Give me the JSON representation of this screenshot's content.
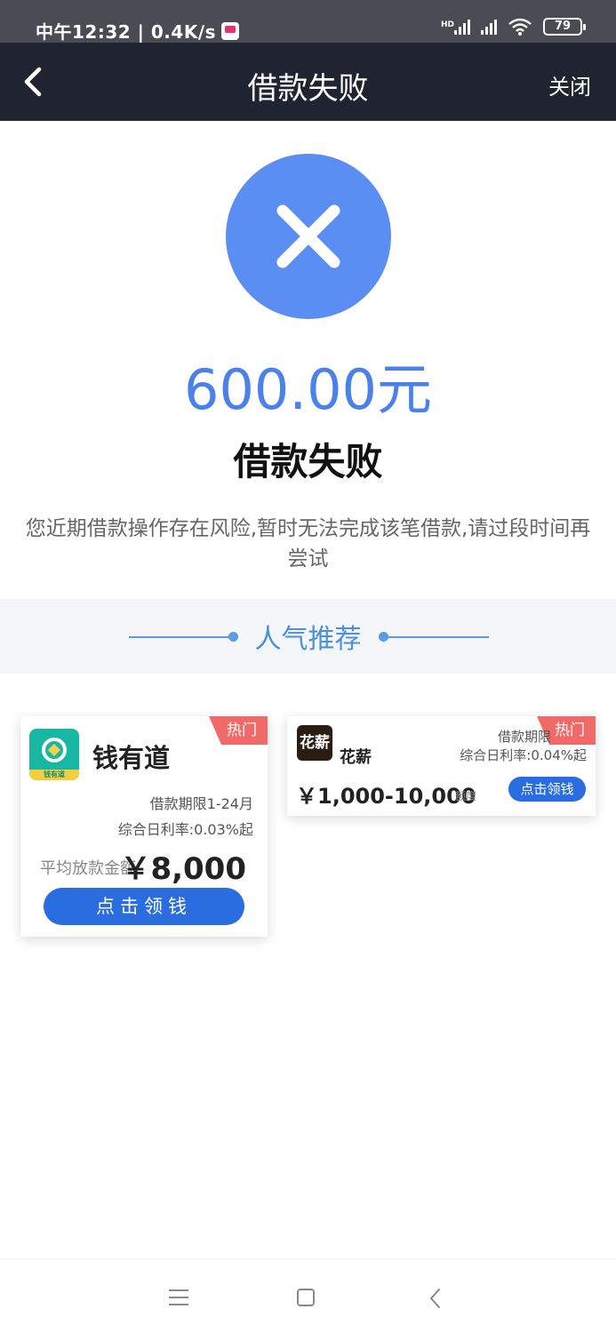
{
  "status_bar": {
    "time_speed": "中午12:32 | 0.4K/s",
    "hd_label": "HD",
    "battery": "79"
  },
  "nav": {
    "title": "借款失败",
    "close_label": "关闭"
  },
  "result": {
    "amount": "600.00元",
    "title": "借款失败",
    "description": "您近期借款操作存在风险,暂时无法完成该笔借款,请过段时间再尝试"
  },
  "recommend": {
    "section_title": "人气推荐",
    "cards": [
      {
        "hot_badge": "热门",
        "logo_text": "钱有道",
        "name": "钱有道",
        "term": "借款期限1-24月",
        "rate": "综合日利率:0.03%起",
        "amount_label": "平均放款金额",
        "amount": "￥8,000",
        "cta": "点击领钱"
      },
      {
        "hot_badge": "热门",
        "logo_text": "花薪",
        "name": "花薪",
        "term": "借款期限",
        "rate": "综合日利率:0.04%起",
        "amount": "￥1,000-10,000",
        "amount_unit": "额度",
        "cta": "点击领钱"
      }
    ]
  },
  "colors": {
    "accent_blue": "#2a6de0",
    "fail_circle": "#5b8ef2",
    "amount_text": "#4a81ea",
    "hot_badge": "#f06a68",
    "nav_bg": "#1f2430"
  }
}
